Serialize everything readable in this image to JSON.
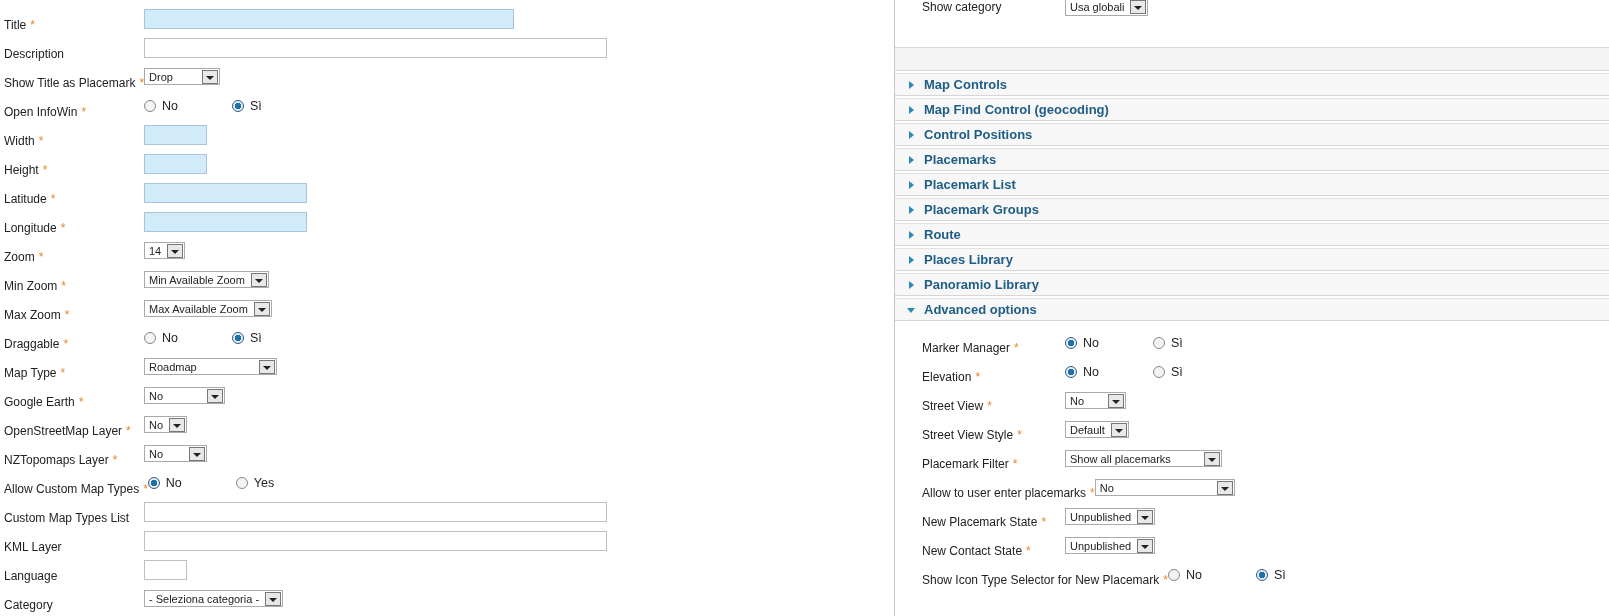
{
  "required_mark": "*",
  "left_fields": [
    {
      "label": "Title",
      "required": true,
      "kind": "text",
      "invalid": true
    },
    {
      "label": "Description",
      "required": false,
      "kind": "text",
      "invalid": false
    },
    {
      "label": "Show Title as Placemark",
      "required": true,
      "kind": "select",
      "value": "Drop"
    },
    {
      "label": "Open InfoWin",
      "required": true,
      "kind": "radio",
      "options": [
        {
          "label": "No",
          "selected": false
        },
        {
          "label": "Sì",
          "selected": true
        }
      ]
    },
    {
      "label": "Width",
      "required": true,
      "kind": "text",
      "invalid": true
    },
    {
      "label": "Height",
      "required": true,
      "kind": "text",
      "invalid": true
    },
    {
      "label": "Latitude",
      "required": true,
      "kind": "text",
      "invalid": true
    },
    {
      "label": "Longitude",
      "required": true,
      "kind": "text",
      "invalid": true
    },
    {
      "label": "Zoom",
      "required": true,
      "kind": "select",
      "value": "14"
    },
    {
      "label": "Min Zoom",
      "required": true,
      "kind": "select",
      "value": "Min Available Zoom"
    },
    {
      "label": "Max Zoom",
      "required": true,
      "kind": "select",
      "value": "Max Available Zoom"
    },
    {
      "label": "Draggable",
      "required": true,
      "kind": "radio",
      "options": [
        {
          "label": "No",
          "selected": false
        },
        {
          "label": "Sì",
          "selected": true
        }
      ]
    },
    {
      "label": "Map Type",
      "required": true,
      "kind": "select",
      "value": "Roadmap"
    },
    {
      "label": "Google Earth",
      "required": true,
      "kind": "select",
      "value": "No"
    },
    {
      "label": "OpenStreetMap Layer",
      "required": true,
      "kind": "select",
      "value": "No"
    },
    {
      "label": "NZTopomaps Layer",
      "required": true,
      "kind": "select",
      "value": "No"
    },
    {
      "label": "Allow Custom Map Types",
      "required": true,
      "kind": "radio",
      "options": [
        {
          "label": "No",
          "selected": true
        },
        {
          "label": "Yes",
          "selected": false
        }
      ]
    },
    {
      "label": "Custom Map Types List",
      "required": false,
      "kind": "text",
      "invalid": false
    },
    {
      "label": "KML Layer",
      "required": false,
      "kind": "text",
      "invalid": false
    },
    {
      "label": "Language",
      "required": false,
      "kind": "text",
      "invalid": false
    },
    {
      "label": "Category",
      "required": false,
      "kind": "select",
      "value": "- Seleziona categoria -"
    }
  ],
  "top_field": {
    "label": "Show category",
    "value": "Usa globali"
  },
  "sections": [
    {
      "title": "Map Controls",
      "expanded": false
    },
    {
      "title": "Map Find Control (geocoding)",
      "expanded": false
    },
    {
      "title": "Control Positions",
      "expanded": false
    },
    {
      "title": "Placemarks",
      "expanded": false
    },
    {
      "title": "Placemark List",
      "expanded": false
    },
    {
      "title": "Placemark Groups",
      "expanded": false
    },
    {
      "title": "Route",
      "expanded": false
    },
    {
      "title": "Places Library",
      "expanded": false
    },
    {
      "title": "Panoramio Library",
      "expanded": false
    },
    {
      "title": "Advanced options",
      "expanded": true
    }
  ],
  "advanced_fields": [
    {
      "label": "Marker Manager",
      "required": true,
      "kind": "radio",
      "options": [
        {
          "label": "No",
          "selected": true
        },
        {
          "label": "Sì",
          "selected": false
        }
      ]
    },
    {
      "label": "Elevation",
      "required": true,
      "kind": "radio",
      "options": [
        {
          "label": "No",
          "selected": true
        },
        {
          "label": "Sì",
          "selected": false
        }
      ]
    },
    {
      "label": "Street View",
      "required": true,
      "kind": "select",
      "value": "No"
    },
    {
      "label": "Street View Style",
      "required": true,
      "kind": "select",
      "value": "Default"
    },
    {
      "label": "Placemark Filter",
      "required": true,
      "kind": "select",
      "value": "Show all placemarks"
    },
    {
      "label": "Allow to user enter placemarks",
      "required": true,
      "kind": "select",
      "value": "No"
    },
    {
      "label": "New Placemark State",
      "required": true,
      "kind": "select",
      "value": "Unpublished"
    },
    {
      "label": "New Contact State",
      "required": true,
      "kind": "select",
      "value": "Unpublished"
    },
    {
      "label": "Show Icon Type Selector for New Placemark",
      "required": true,
      "kind": "radio",
      "options": [
        {
          "label": "No",
          "selected": false
        },
        {
          "label": "Sì",
          "selected": true
        }
      ]
    }
  ]
}
